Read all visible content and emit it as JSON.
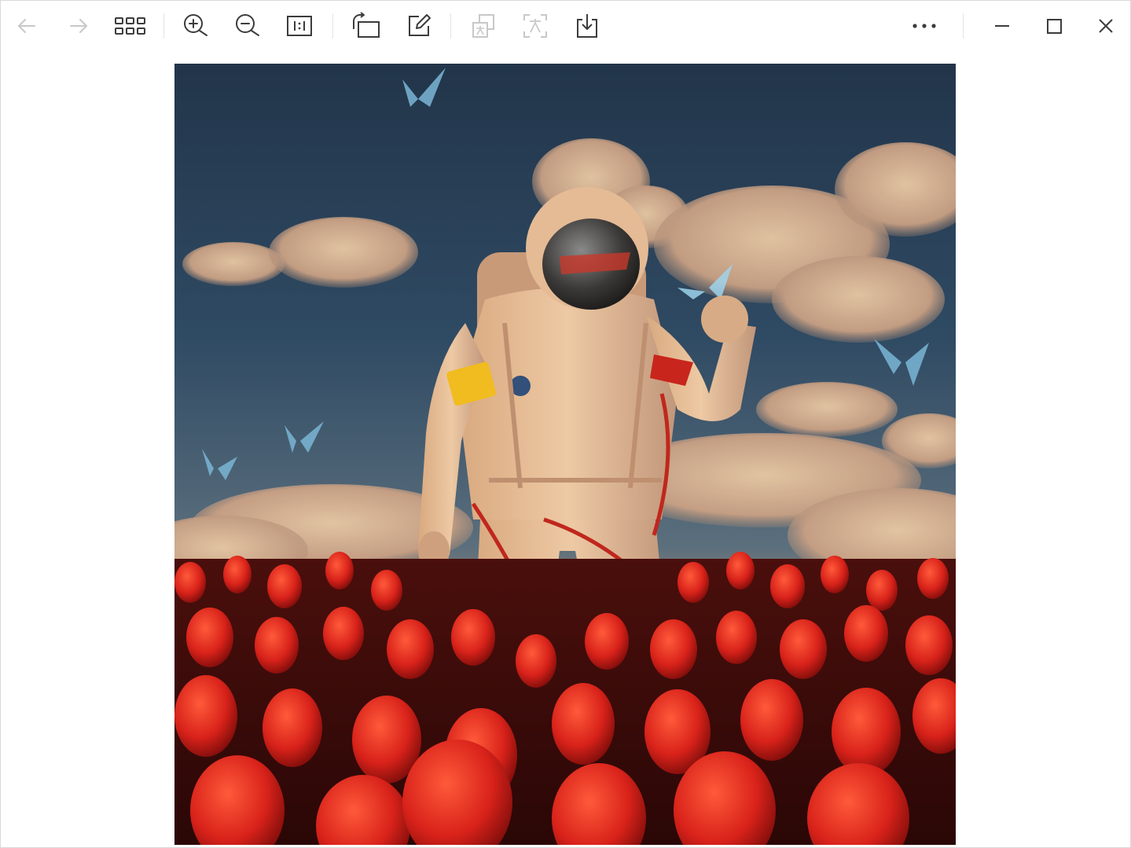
{
  "toolbar": {
    "icons": {
      "back": "arrow-left-icon",
      "forward": "arrow-right-icon",
      "grid": "grid-icon",
      "zoom_in": "zoom-in-icon",
      "zoom_out": "zoom-out-icon",
      "actual_size": "actual-size-icon",
      "rotate": "rotate-icon",
      "edit": "edit-icon",
      "translate": "translate-icon",
      "ocr": "text-recognition-icon",
      "save": "download-icon",
      "more": "more-icon",
      "minimize": "minimize-icon",
      "maximize": "maximize-icon",
      "close": "close-icon"
    },
    "disabled": [
      "back",
      "forward",
      "translate",
      "ocr"
    ],
    "colors": {
      "icon": "#3c3c3c",
      "icon_disabled": "#c8c8c8",
      "separator": "#e3e3e3"
    }
  },
  "image": {
    "subject": "astronaut-in-tulip-field"
  }
}
